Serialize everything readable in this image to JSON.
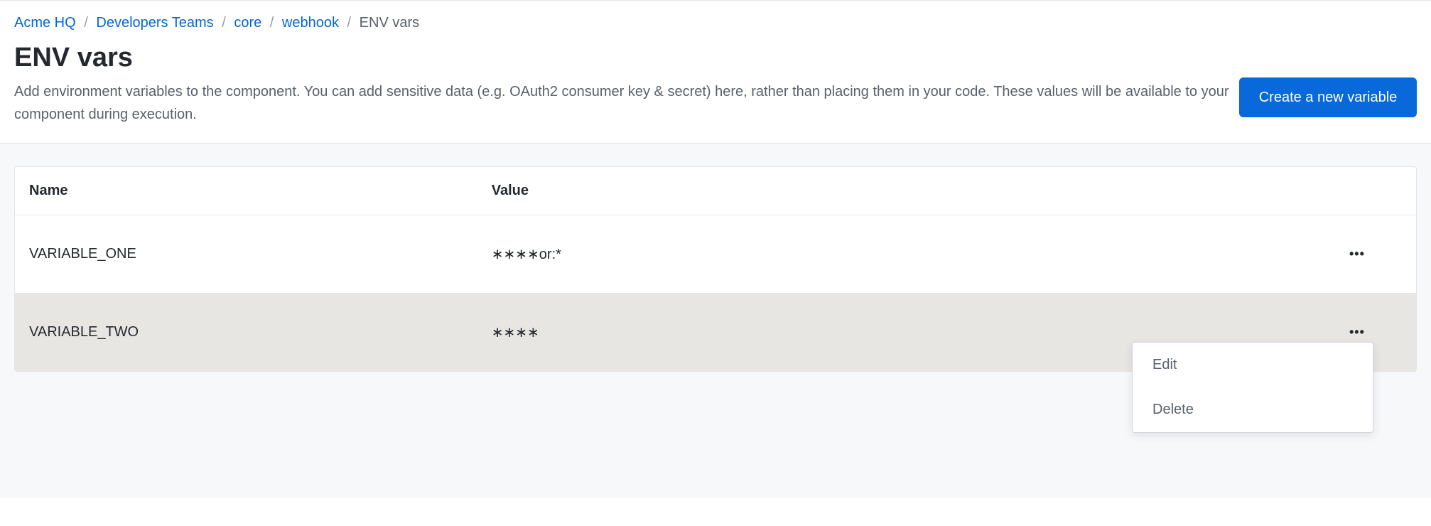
{
  "breadcrumb": {
    "items": [
      {
        "label": "Acme HQ",
        "link": true
      },
      {
        "label": "Developers Teams",
        "link": true
      },
      {
        "label": "core",
        "link": true
      },
      {
        "label": "webhook",
        "link": true
      }
    ],
    "current": "ENV vars"
  },
  "header": {
    "title": "ENV vars",
    "description": "Add environment variables to the component. You can add sensitive data (e.g. OAuth2 consumer key & secret) here, rather than placing them in your code. These values will be available to your component during execution.",
    "create_button": "Create a new variable"
  },
  "table": {
    "columns": {
      "name": "Name",
      "value": "Value"
    },
    "rows": [
      {
        "name": "VARIABLE_ONE",
        "value": "∗∗∗∗or:*"
      },
      {
        "name": "VARIABLE_TWO",
        "value": "∗∗∗∗"
      }
    ]
  },
  "dropdown": {
    "edit": "Edit",
    "delete": "Delete"
  }
}
